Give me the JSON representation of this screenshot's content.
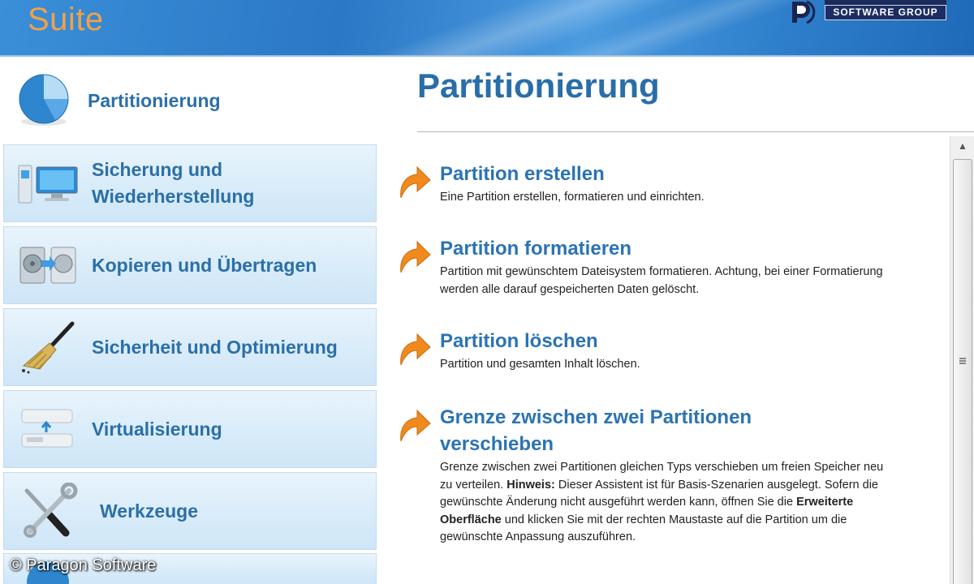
{
  "header": {
    "app_title": "Suite",
    "brand_text": "SOFTWARE GROUP"
  },
  "sidebar": {
    "items": [
      {
        "label": "Partitionierung",
        "icon": "pie-chart-icon",
        "active": true
      },
      {
        "label": "Sicherung und Wiederherstellung",
        "icon": "backup-computer-icon",
        "active": false
      },
      {
        "label": "Kopieren und Übertragen",
        "icon": "copy-disk-icon",
        "active": false
      },
      {
        "label": "Sicherheit und Optimierung",
        "icon": "broom-icon",
        "active": false
      },
      {
        "label": "Virtualisierung",
        "icon": "virtual-drive-icon",
        "active": false
      },
      {
        "label": "Werkzeuge",
        "icon": "tools-icon",
        "active": false
      }
    ]
  },
  "main": {
    "page_title": "Partitionierung",
    "tasks": [
      {
        "title": "Partition erstellen",
        "desc": "Eine Partition erstellen, formatieren und einrichten."
      },
      {
        "title": "Partition formatieren",
        "desc": "Partition mit gewünschtem Dateisystem formatieren. Achtung, bei einer Formatierung werden alle darauf gespeicherten Daten gelöscht."
      },
      {
        "title": "Partition löschen",
        "desc": "Partition und gesamten Inhalt löschen."
      },
      {
        "title": "Grenze zwischen zwei Partitionen verschieben",
        "desc_parts": [
          "Grenze zwischen zwei Partitionen gleichen Typs verschieben um freien Speicher neu zu verteilen. ",
          "Hinweis:",
          " Dieser Assistent ist für Basis-Szenarien ausgelegt. Sofern die gewünschte Änderung nicht ausgeführt werden kann, öffnen Sie die ",
          "Erweiterte Oberfläche",
          " und klicken Sie mit der rechten Maustaste auf die Partition um die gewünschte Anpassung auszuführen."
        ]
      }
    ]
  },
  "watermark": "© Paragon Software",
  "colors": {
    "accent_blue": "#2b73b4",
    "title_orange": "#f2a04a",
    "arrow_orange": "#f08a1c"
  }
}
